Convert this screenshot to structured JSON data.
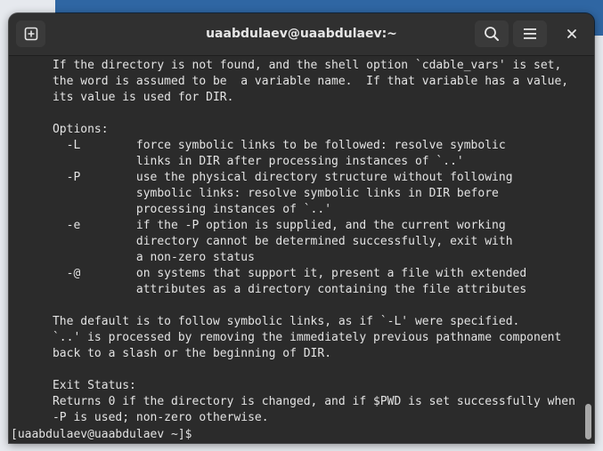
{
  "window": {
    "title": "uaabdulaev@uaabdulaev:~"
  },
  "header_buttons": {
    "new_tab_icon": "new-tab-icon",
    "search_icon": "search-icon",
    "menu_icon": "hamburger-menu-icon",
    "close_icon": "close-icon"
  },
  "colors": {
    "terminal_background": "#2b2b2b",
    "terminal_text": "#e3e3e3",
    "headerbar": "#303030"
  },
  "terminal": {
    "lines": [
      "      If the directory is not found, and the shell option `cdable_vars' is set,",
      "      the word is assumed to be  a variable name.  If that variable has a value,",
      "      its value is used for DIR.",
      "",
      "      Options:",
      "        -L        force symbolic links to be followed: resolve symbolic",
      "                  links in DIR after processing instances of `..'",
      "        -P        use the physical directory structure without following",
      "                  symbolic links: resolve symbolic links in DIR before",
      "                  processing instances of `..'",
      "        -e        if the -P option is supplied, and the current working",
      "                  directory cannot be determined successfully, exit with",
      "                  a non-zero status",
      "        -@        on systems that support it, present a file with extended",
      "                  attributes as a directory containing the file attributes",
      "",
      "      The default is to follow symbolic links, as if `-L' were specified.",
      "      `..' is processed by removing the immediately previous pathname component",
      "      back to a slash or the beginning of DIR.",
      "",
      "      Exit Status:",
      "      Returns 0 if the directory is changed, and if $PWD is set successfully when",
      "      -P is used; non-zero otherwise."
    ],
    "prompt": "[uaabdulaev@uaabdulaev ~]$ "
  }
}
